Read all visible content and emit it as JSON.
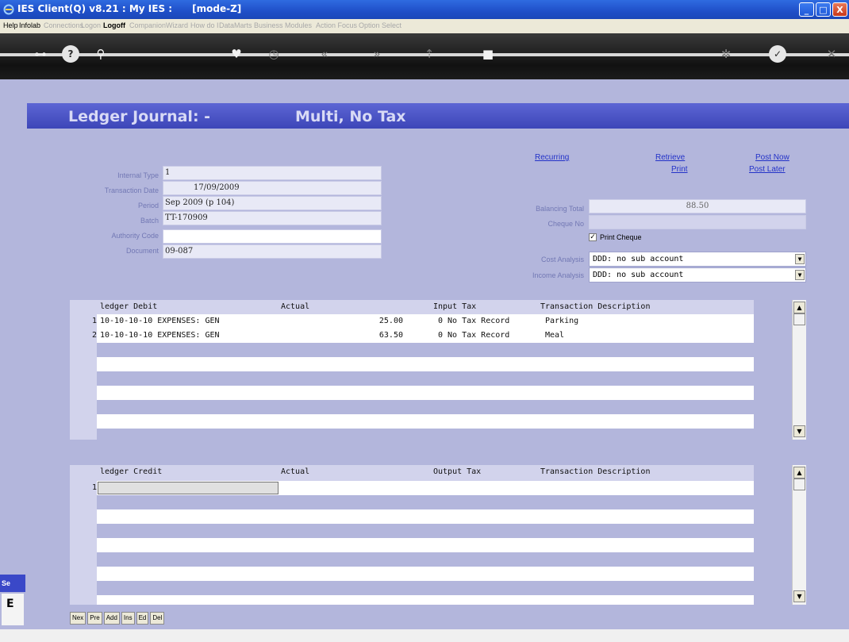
{
  "titlebar": {
    "title": "IES Client(Q) v8.21 : My IES :      [mode-Z]",
    "minimize": "_",
    "maximize": "□",
    "close": "X"
  },
  "menu": {
    "items": [
      {
        "label": "Help",
        "enabled": true
      },
      {
        "label": "Infolab",
        "enabled": true
      },
      {
        "label": "Connections",
        "enabled": false
      },
      {
        "label": "Logon",
        "enabled": false
      },
      {
        "label": "Logoff",
        "enabled": true
      },
      {
        "label": "Companion",
        "enabled": false
      },
      {
        "label": "Wizard",
        "enabled": false
      },
      {
        "label": "How do I",
        "enabled": false
      },
      {
        "label": "DataMarts",
        "enabled": false
      },
      {
        "label": "Business Modules",
        "enabled": false
      },
      {
        "label": "Action Focus",
        "enabled": false
      },
      {
        "label": "Option Select",
        "enabled": false
      }
    ]
  },
  "toolbar": {
    "icons": [
      "key-icon",
      "help-icon",
      "search-icon",
      "heart-icon",
      "clock-icon",
      "rewind-icon",
      "forward-icon",
      "insert-icon",
      "square-icon",
      "gear-icon",
      "check-icon",
      "close-icon"
    ],
    "glyphs": [
      "⊶",
      "?",
      "⚲",
      "♥",
      "◷",
      "«",
      "»",
      "⇡",
      "■",
      "✲",
      "✓",
      "✕"
    ]
  },
  "banner": {
    "title_left": "Ledger Journal: -",
    "title_right": "Multi, No Tax"
  },
  "form": {
    "internal_type": {
      "label": "Internal Type",
      "value": "1"
    },
    "transaction_date": {
      "label": "Transaction Date",
      "value": "17/09/2009"
    },
    "period": {
      "label": "Period",
      "value": "Sep 2009 (p 104)"
    },
    "batch": {
      "label": "Batch",
      "value": "TT-170909"
    },
    "authority_code": {
      "label": "Authority Code",
      "value": ""
    },
    "document": {
      "label": "Document",
      "value": "09-087"
    }
  },
  "links": {
    "recurring": "Recurring",
    "retrieve": "Retrieve",
    "print": "Print",
    "post_now": "Post Now",
    "post_later": "Post Later"
  },
  "right_form": {
    "balancing_total": {
      "label": "Balancing Total",
      "value": "88.50"
    },
    "cheque_no": {
      "label": "Cheque No",
      "value": ""
    },
    "print_cheque": {
      "label": "Print Cheque",
      "checked": true,
      "mark": "✓"
    },
    "cost_analysis": {
      "label": "Cost Analysis",
      "value": "DDD: no sub account"
    },
    "income_analysis": {
      "label": "Income Analysis",
      "value": "DDD: no sub account"
    }
  },
  "debit_grid": {
    "headers": {
      "account": "ledger Debit",
      "actual": "Actual",
      "tax": "Input Tax",
      "description": "Transaction Description"
    },
    "rows": [
      {
        "num": "1",
        "account": "10-10-10-10 EXPENSES: GEN",
        "actual": "25.00",
        "tax": "0 No Tax Record",
        "description": "Parking"
      },
      {
        "num": "2",
        "account": "10-10-10-10 EXPENSES: GEN",
        "actual": "63.50",
        "tax": "0 No Tax Record",
        "description": "Meal"
      }
    ]
  },
  "credit_grid": {
    "headers": {
      "account": "ledger Credit",
      "actual": "Actual",
      "tax": "Output Tax",
      "description": "Transaction Description"
    },
    "rows": [
      {
        "num": "1",
        "account": "",
        "actual": "",
        "tax": "",
        "description": ""
      }
    ]
  },
  "nav_buttons": [
    "Nex",
    "Pre",
    "Add",
    "Ins",
    "Ed",
    "Del"
  ],
  "sidebar": {
    "label": "Se",
    "char": "E"
  },
  "scroll": {
    "up": "▲",
    "down": "▼"
  }
}
